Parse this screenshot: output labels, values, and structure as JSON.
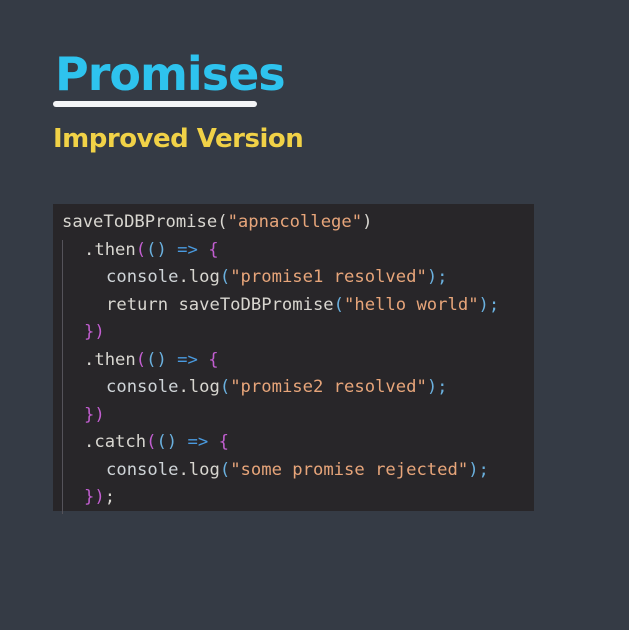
{
  "slide": {
    "title": "Promises",
    "subtitle": "Improved Version"
  },
  "code": {
    "lines": [
      {
        "indent": 0,
        "tokens": [
          {
            "t": "saveToDBPromise",
            "c": "plain"
          },
          {
            "t": "(",
            "c": "plain"
          },
          {
            "t": "\"apnacollege\"",
            "c": "str"
          },
          {
            "t": ")",
            "c": "plain"
          }
        ]
      },
      {
        "indent": 1,
        "tokens": [
          {
            "t": ".then",
            "c": "plain"
          },
          {
            "t": "(",
            "c": "purple"
          },
          {
            "t": "()",
            "c": "blue"
          },
          {
            "t": " => ",
            "c": "arrow"
          },
          {
            "t": "{",
            "c": "purple"
          }
        ]
      },
      {
        "indent": 2,
        "tokens": [
          {
            "t": "console",
            "c": "ident"
          },
          {
            "t": ".log",
            "c": "plain"
          },
          {
            "t": "(",
            "c": "blue"
          },
          {
            "t": "\"promise1 resolved\"",
            "c": "str"
          },
          {
            "t": ");",
            "c": "blue"
          }
        ]
      },
      {
        "indent": 2,
        "tokens": [
          {
            "t": "return ",
            "c": "plain"
          },
          {
            "t": "saveToDBPromise",
            "c": "plain"
          },
          {
            "t": "(",
            "c": "blue"
          },
          {
            "t": "\"hello world\"",
            "c": "str"
          },
          {
            "t": ");",
            "c": "blue"
          }
        ]
      },
      {
        "indent": 1,
        "tokens": [
          {
            "t": "})",
            "c": "purple"
          }
        ]
      },
      {
        "indent": 1,
        "tokens": [
          {
            "t": ".then",
            "c": "plain"
          },
          {
            "t": "(",
            "c": "purple"
          },
          {
            "t": "()",
            "c": "blue"
          },
          {
            "t": " => ",
            "c": "arrow"
          },
          {
            "t": "{",
            "c": "purple"
          }
        ]
      },
      {
        "indent": 2,
        "tokens": [
          {
            "t": "console",
            "c": "ident"
          },
          {
            "t": ".log",
            "c": "plain"
          },
          {
            "t": "(",
            "c": "blue"
          },
          {
            "t": "\"promise2 resolved\"",
            "c": "str"
          },
          {
            "t": ");",
            "c": "blue"
          }
        ]
      },
      {
        "indent": 1,
        "tokens": [
          {
            "t": "})",
            "c": "purple"
          }
        ]
      },
      {
        "indent": 1,
        "tokens": [
          {
            "t": ".catch",
            "c": "plain"
          },
          {
            "t": "(",
            "c": "purple"
          },
          {
            "t": "()",
            "c": "blue"
          },
          {
            "t": " => ",
            "c": "arrow"
          },
          {
            "t": "{",
            "c": "purple"
          }
        ]
      },
      {
        "indent": 2,
        "tokens": [
          {
            "t": "console",
            "c": "ident"
          },
          {
            "t": ".log",
            "c": "plain"
          },
          {
            "t": "(",
            "c": "blue"
          },
          {
            "t": "\"some promise rejected\"",
            "c": "str"
          },
          {
            "t": ");",
            "c": "blue"
          }
        ]
      },
      {
        "indent": 1,
        "tokens": [
          {
            "t": "})",
            "c": "purple"
          },
          {
            "t": ";",
            "c": "plain"
          }
        ]
      }
    ]
  },
  "colors": {
    "background": "#353b45",
    "title": "#2ec3ee",
    "subtitle": "#f1d247",
    "code_background": "#282629",
    "string": "#e7a57a",
    "keyword_purple": "#c25ed0",
    "paren_blue": "#6ab0de"
  }
}
